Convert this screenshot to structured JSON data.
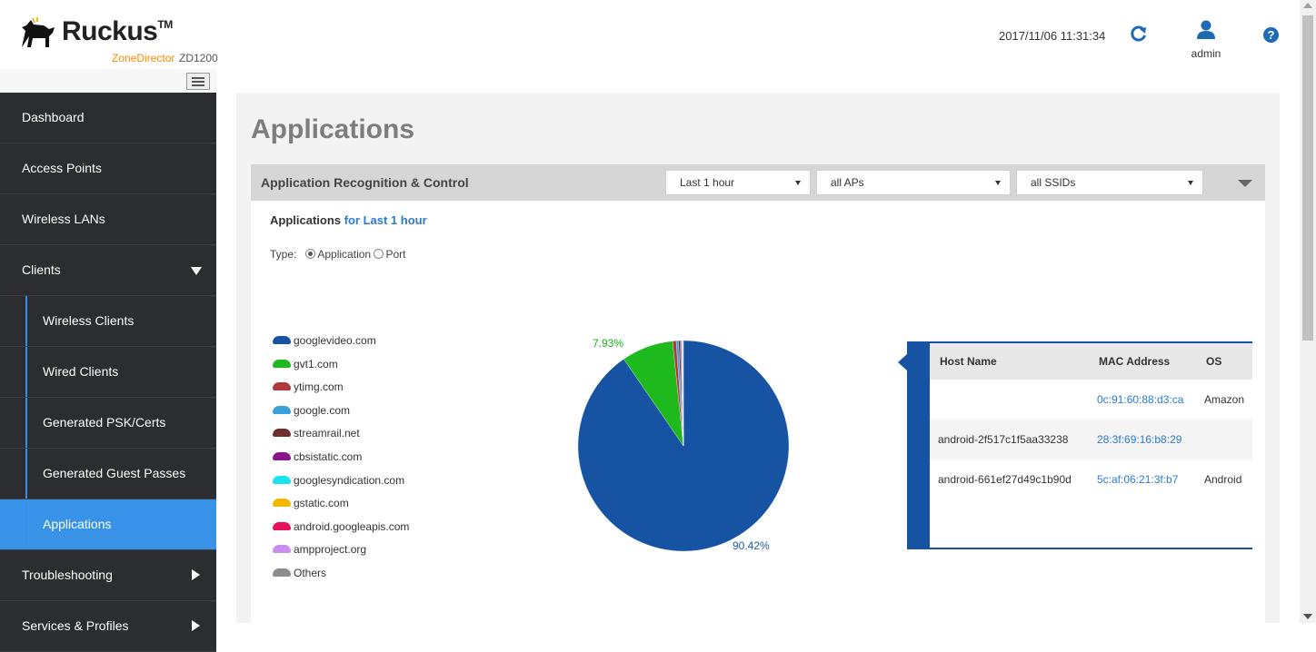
{
  "header": {
    "brand": "Ruckus",
    "brand_tm": "TM",
    "product": "ZoneDirector",
    "model": "ZD1200",
    "datetime": "2017/11/06  11:31:34",
    "user": "admin",
    "help": "?"
  },
  "sidebar": {
    "items": [
      {
        "label": "Dashboard"
      },
      {
        "label": "Access Points"
      },
      {
        "label": "Wireless LANs"
      },
      {
        "label": "Clients"
      },
      {
        "label": "Wireless Clients"
      },
      {
        "label": "Wired Clients"
      },
      {
        "label": "Generated PSK/Certs"
      },
      {
        "label": "Generated Guest Passes"
      },
      {
        "label": "Applications"
      },
      {
        "label": "Troubleshooting"
      },
      {
        "label": "Services & Profiles"
      }
    ]
  },
  "page": {
    "title": "Applications"
  },
  "panel": {
    "title": "Application Recognition & Control",
    "time_filter": "Last 1 hour",
    "ap_filter": "all APs",
    "ssid_filter": "all SSIDs",
    "heading_prefix": "Applications",
    "heading_suffix": "for Last 1 hour",
    "type_label": "Type:",
    "type_option_app": "Application",
    "type_option_port": "Port"
  },
  "chart_data": {
    "type": "pie",
    "title": "",
    "series": [
      {
        "name": "googlevideo.com",
        "value": 90.42,
        "color": "#1654a3"
      },
      {
        "name": "gvt1.com",
        "value": 7.93,
        "color": "#1db91d"
      },
      {
        "name": "ytimg.com",
        "value": 0.55,
        "color": "#b0393a"
      },
      {
        "name": "google.com",
        "value": 0.35,
        "color": "#3aa2d8"
      },
      {
        "name": "streamrail.net",
        "value": 0.25,
        "color": "#6e2f2f"
      },
      {
        "name": "cbsistatic.com",
        "value": 0.15,
        "color": "#8a148a"
      },
      {
        "name": "googlesyndication.com",
        "value": 0.1,
        "color": "#19e3f0"
      },
      {
        "name": "gstatic.com",
        "value": 0.08,
        "color": "#f5b800"
      },
      {
        "name": "android.googleapis.com",
        "value": 0.07,
        "color": "#e8105c"
      },
      {
        "name": "ampproject.org",
        "value": 0.05,
        "color": "#c88ef0"
      },
      {
        "name": "Others",
        "value": 0.05,
        "color": "#8c8c8c"
      }
    ],
    "labels": [
      {
        "text": "7.93%"
      },
      {
        "text": "90.42%"
      }
    ],
    "legend": "left"
  },
  "host_table": {
    "columns": [
      "Host Name",
      "MAC Address",
      "OS"
    ],
    "rows": [
      {
        "host": "",
        "mac": "0c:91:60:88:d3:ca",
        "os": "Amazon"
      },
      {
        "host": "android-2f517c1f5aa33238",
        "mac": "28:3f:69:16:b8:29",
        "os": ""
      },
      {
        "host": "android-661ef27d49c1b90d",
        "mac": "5c:af:06:21:3f:b7",
        "os": "Android"
      }
    ]
  }
}
